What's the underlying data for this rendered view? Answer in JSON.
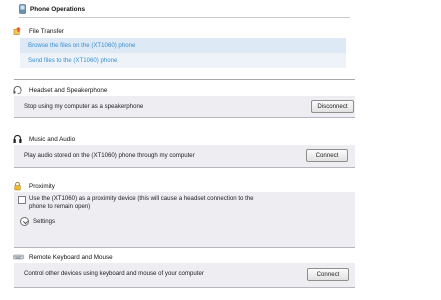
{
  "header": {
    "title": "Phone Operations"
  },
  "file_transfer": {
    "title": "File Transfer",
    "links": [
      "Browse the files on the (XT1060) phone",
      "Send files to the (XT1060) phone"
    ]
  },
  "headset": {
    "title": "Headset and Speakerphone",
    "description": "Stop using my computer as a speakerphone",
    "button": "Disconnect"
  },
  "music": {
    "title": "Music and Audio",
    "description": "Play audio stored on the (XT1060) phone through my computer",
    "button": "Connect"
  },
  "proximity": {
    "title": "Proximity",
    "checkbox_label": "Use the (XT1060) as a proximity device (this will cause a headset connection to the phone to remain open)",
    "checked": false,
    "settings_label": "Settings"
  },
  "keyboard": {
    "title": "Remote Keyboard and Mouse",
    "description": "Control other devices using keyboard and mouse of your computer",
    "button": "Connect"
  },
  "colors": {
    "link": "#3a8fcf",
    "link_row_bg": "#dde9f5",
    "panel_bg": "#eeedf1"
  },
  "icons": [
    "phone-icon",
    "file-transfer-icon",
    "headset-icon",
    "music-icon",
    "lock-icon",
    "keyboard-icon",
    "chevron-down-icon"
  ]
}
